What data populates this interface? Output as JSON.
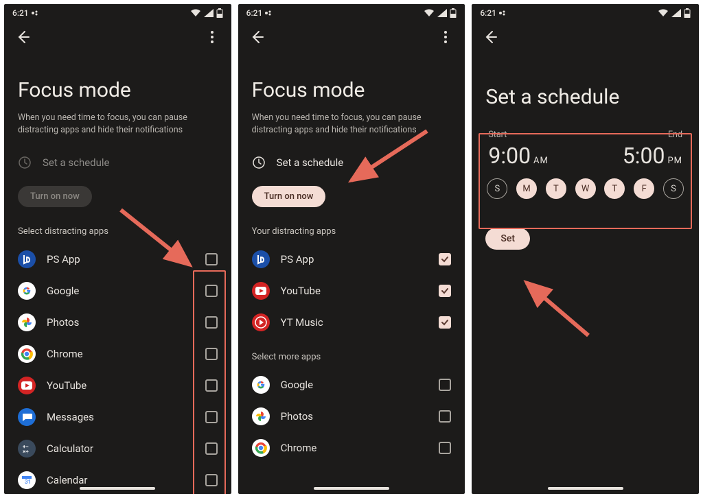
{
  "status": {
    "time": "6:21",
    "wifi": true,
    "signal": true,
    "battery": "half"
  },
  "screen1": {
    "title": "Focus mode",
    "subtitle": "When you need time to focus, you can pause distracting apps and hide their notifications",
    "schedule_label": "Set a schedule",
    "turn_on_label": "Turn on now",
    "section_label": "Select distracting apps",
    "apps": [
      {
        "name": "PS App",
        "icon_bg": "#1b4fa8",
        "glyph": "ps",
        "checked": false
      },
      {
        "name": "Google",
        "icon_bg": "#ffffff",
        "glyph": "g",
        "checked": false
      },
      {
        "name": "Photos",
        "icon_bg": "#ffffff",
        "glyph": "ph",
        "checked": false
      },
      {
        "name": "Chrome",
        "icon_bg": "#ffffff",
        "glyph": "ch",
        "checked": false
      },
      {
        "name": "YouTube",
        "icon_bg": "#d32424",
        "glyph": "yt",
        "checked": false
      },
      {
        "name": "Messages",
        "icon_bg": "#1e6ed6",
        "glyph": "ms",
        "checked": false
      },
      {
        "name": "Calculator",
        "icon_bg": "#3a4a5c",
        "glyph": "ca",
        "checked": false
      },
      {
        "name": "Calendar",
        "icon_bg": "#ffffff",
        "glyph": "cal",
        "checked": false
      }
    ]
  },
  "screen2": {
    "title": "Focus mode",
    "subtitle": "When you need time to focus, you can pause distracting apps and hide their notifications",
    "schedule_label": "Set a schedule",
    "turn_on_label": "Turn on now",
    "section_label_sel": "Your distracting apps",
    "section_label_more": "Select more apps",
    "apps_sel": [
      {
        "name": "PS App",
        "icon_bg": "#1b4fa8",
        "glyph": "ps",
        "checked": true
      },
      {
        "name": "YouTube",
        "icon_bg": "#d32424",
        "glyph": "yt",
        "checked": true
      },
      {
        "name": "YT Music",
        "icon_bg": "#d32424",
        "glyph": "ym",
        "checked": true
      }
    ],
    "apps_more": [
      {
        "name": "Google",
        "icon_bg": "#ffffff",
        "glyph": "g",
        "checked": false
      },
      {
        "name": "Photos",
        "icon_bg": "#ffffff",
        "glyph": "ph",
        "checked": false
      },
      {
        "name": "Chrome",
        "icon_bg": "#ffffff",
        "glyph": "ch",
        "checked": false
      }
    ]
  },
  "screen3": {
    "title": "Set a schedule",
    "start_label": "Start",
    "end_label": "End",
    "start_time": "9:00",
    "start_suffix": "AM",
    "end_time": "5:00",
    "end_suffix": "PM",
    "days": [
      {
        "letter": "S",
        "selected": false
      },
      {
        "letter": "M",
        "selected": true
      },
      {
        "letter": "T",
        "selected": true
      },
      {
        "letter": "W",
        "selected": true
      },
      {
        "letter": "T",
        "selected": true
      },
      {
        "letter": "F",
        "selected": true
      },
      {
        "letter": "S",
        "selected": false
      }
    ],
    "set_label": "Set"
  }
}
